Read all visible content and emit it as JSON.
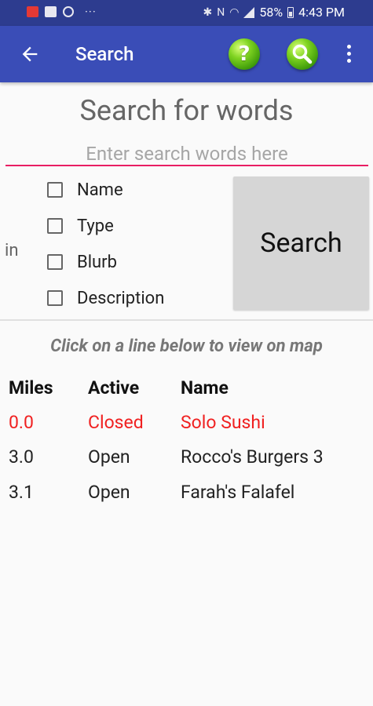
{
  "status_bar": {
    "battery": "58%",
    "time": "4:43 PM",
    "overflow_dots": "···"
  },
  "app_bar": {
    "title": "Search",
    "help_glyph": "?",
    "icons": [
      "back-arrow-icon",
      "help-icon",
      "magnifier-icon",
      "overflow-menu-icon"
    ]
  },
  "search": {
    "heading": "Search for words",
    "placeholder": "Enter search words here",
    "value": "",
    "in_label": "in",
    "fields": [
      {
        "label": "Name",
        "checked": false
      },
      {
        "label": "Type",
        "checked": false
      },
      {
        "label": "Blurb",
        "checked": false
      },
      {
        "label": "Description",
        "checked": false
      }
    ],
    "button_label": "Search"
  },
  "results": {
    "hint": "Click on a line below to view on map",
    "headers": {
      "miles": "Miles",
      "active": "Active",
      "name": "Name"
    },
    "rows": [
      {
        "miles": "0.0",
        "active": "Closed",
        "name": "Solo Sushi",
        "status": "closed"
      },
      {
        "miles": "3.0",
        "active": "Open",
        "name": "Rocco's Burgers 3",
        "status": "open"
      },
      {
        "miles": "3.1",
        "active": "Open",
        "name": "Farah's Falafel",
        "status": "open"
      }
    ]
  },
  "colors": {
    "status_bar": "#2d3c8f",
    "app_bar": "#3a4db7",
    "accent_underline": "#e91e63",
    "closed_text": "#f02020",
    "button_bg": "#d6d6d6"
  }
}
